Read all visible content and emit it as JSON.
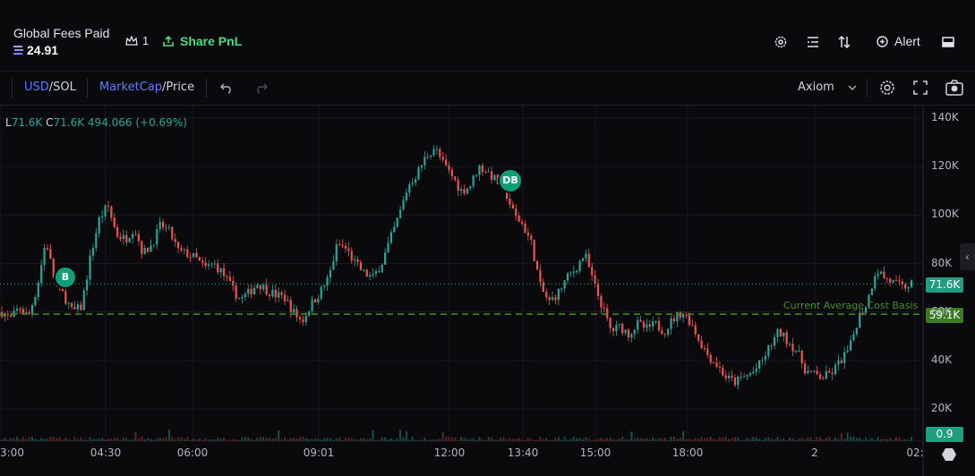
{
  "header": {
    "fees_label": "Global Fees Paid",
    "fees_value": "24.91",
    "crown_count": "1",
    "share_label": "Share PnL",
    "alert_label": "Alert"
  },
  "toolbar": {
    "usd": "USD",
    "sol": "/SOL",
    "marketcap": "MarketCap",
    "price": "/Price",
    "provider": "Axiom"
  },
  "ohlc": {
    "l_key": "L",
    "l_val": "71.6K",
    "c_key": "C",
    "c_val": "71.6K",
    "change": "494.066 (+0.69%)"
  },
  "price_tags": {
    "current": "71.6K",
    "cost_basis": "59.1K",
    "volume": "0.9"
  },
  "cost_basis_label": "Current Average Cost Basis",
  "markers": {
    "buy": "B",
    "dev_buy": "DB"
  },
  "colors": {
    "up": "#26a69a",
    "down": "#ef5350",
    "accent": "#4ade80",
    "cost_basis": "#4a8c2a"
  },
  "chart_data": {
    "type": "candlestick",
    "y_ticks": [
      "140K",
      "120K",
      "100K",
      "80K",
      "60K",
      "40K",
      "20K"
    ],
    "x_ticks": [
      "3:00",
      "04:30",
      "06:00",
      "09:01",
      "12:00",
      "13:40",
      "15:00",
      "18:00",
      "2",
      "02:"
    ],
    "ylim": [
      0,
      145000
    ],
    "close_path_k": [
      60,
      57,
      62,
      58,
      70,
      90,
      72,
      67,
      60,
      62,
      82,
      98,
      104,
      92,
      90,
      95,
      84,
      88,
      96,
      93,
      85,
      84,
      82,
      78,
      80,
      76,
      70,
      65,
      68,
      72,
      69,
      67,
      66,
      60,
      56,
      63,
      68,
      74,
      88,
      86,
      80,
      76,
      74,
      80,
      90,
      100,
      112,
      117,
      124,
      128,
      121,
      116,
      110,
      112,
      120,
      118,
      114,
      110,
      100,
      96,
      88,
      70,
      64,
      68,
      74,
      78,
      84,
      72,
      62,
      52,
      54,
      51,
      55,
      53,
      55,
      52,
      57,
      60,
      56,
      48,
      42,
      38,
      33,
      31,
      33,
      35,
      39,
      46,
      52,
      48,
      44,
      36,
      34,
      33,
      35,
      40,
      45,
      58,
      64,
      78,
      74,
      72,
      70,
      71.6
    ],
    "current_price_k": 71.6,
    "cost_basis_k": 59.1
  }
}
